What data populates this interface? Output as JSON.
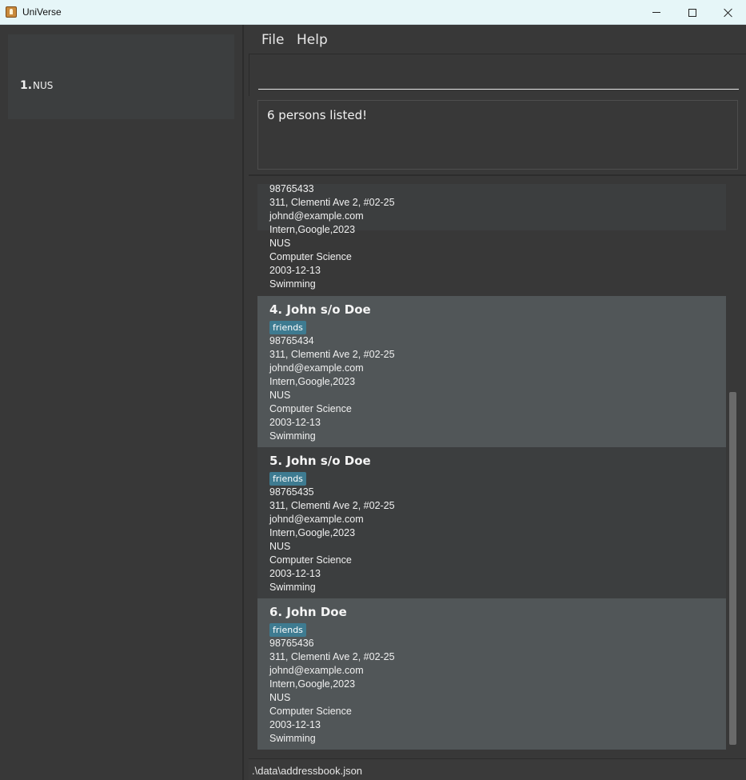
{
  "window": {
    "title": "UniVerse",
    "icon": "app-icon"
  },
  "sidebar": {
    "items": [
      {
        "index": "1.",
        "name": "NUS"
      }
    ]
  },
  "menu": {
    "file": "File",
    "help": "Help"
  },
  "command": {
    "value": "",
    "placeholder": ""
  },
  "result": {
    "message": "6 persons listed!"
  },
  "persons": [
    {
      "title": "",
      "tag": "",
      "phone": "98765433",
      "address": "311, Clementi Ave 2, #02-25",
      "email": "johnd@example.com",
      "experience": "Intern,Google,2023",
      "school": "NUS",
      "major": "Computer Science",
      "birthday": "2003-12-13",
      "hobby": "Swimming"
    },
    {
      "title": "4. John s/o Doe",
      "tag": "friends",
      "phone": "98765434",
      "address": "311, Clementi Ave 2, #02-25",
      "email": "johnd@example.com",
      "experience": "Intern,Google,2023",
      "school": "NUS",
      "major": "Computer Science",
      "birthday": "2003-12-13",
      "hobby": "Swimming"
    },
    {
      "title": "5. John s/o Doe",
      "tag": "friends",
      "phone": "98765435",
      "address": "311, Clementi Ave 2, #02-25",
      "email": "johnd@example.com",
      "experience": "Intern,Google,2023",
      "school": "NUS",
      "major": "Computer Science",
      "birthday": "2003-12-13",
      "hobby": "Swimming"
    },
    {
      "title": "6. John Doe",
      "tag": "friends",
      "phone": "98765436",
      "address": "311, Clementi Ave 2, #02-25",
      "email": "johnd@example.com",
      "experience": "Intern,Google,2023",
      "school": "NUS",
      "major": "Computer Science",
      "birthday": "2003-12-13",
      "hobby": "Swimming"
    }
  ],
  "status": {
    "path": ".\\data\\addressbook.json"
  },
  "colors": {
    "background": "#383838",
    "card_dark": "#3c3e3f",
    "card_light": "#515658",
    "tag": "#3e7b91",
    "titlebar": "#e6f6f8"
  }
}
